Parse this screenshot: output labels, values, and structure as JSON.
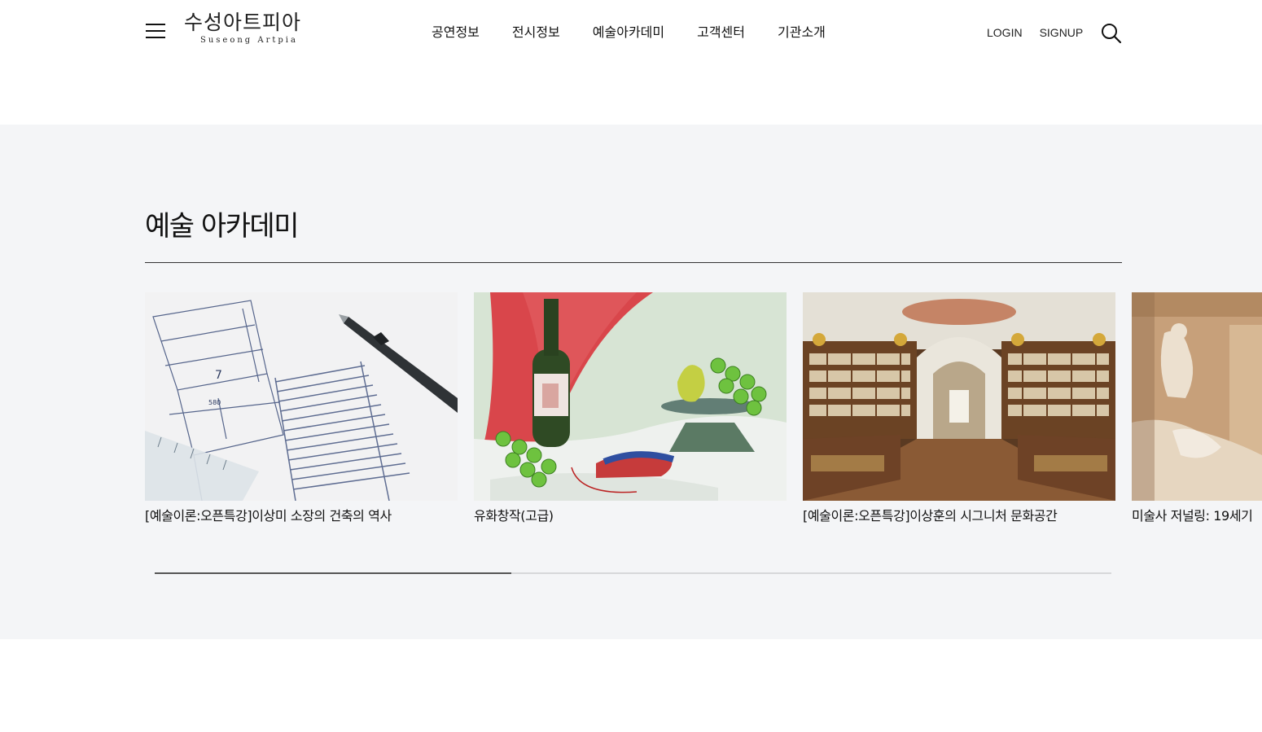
{
  "header": {
    "logo": {
      "korean": "수성아트피아",
      "english": "Suseong Artpia"
    },
    "nav": [
      "공연정보",
      "전시정보",
      "예술아카데미",
      "고객센터",
      "기관소개"
    ],
    "util": {
      "login": "LOGIN",
      "signup": "SIGNUP"
    }
  },
  "academy": {
    "title": "예술 아카데미",
    "cards": [
      {
        "title": "[예술이론:오픈특강]이상미 소장의 건축의 역사",
        "image": "architecture-blueprint-with-pen"
      },
      {
        "title": "유화창작(고급)",
        "image": "still-life-painting-wine-grapes"
      },
      {
        "title": "[예술이론:오픈특강]이상훈의 시그니처 문화공간",
        "image": "baroque-library-interior"
      },
      {
        "title": "미술사 저널링: 19세기",
        "image": "classical-sculpture-fountain"
      }
    ],
    "scroll_progress": 0.373
  },
  "colors": {
    "section_bg": "#f4f5f7",
    "text": "#111111",
    "scroll_track": "#d7d8da",
    "scroll_thumb": "#555555"
  }
}
